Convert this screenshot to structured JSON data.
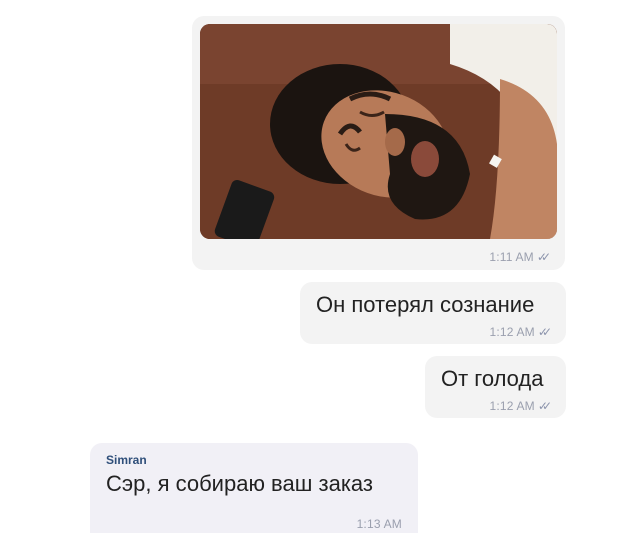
{
  "messages": [
    {
      "type": "image",
      "direction": "outgoing",
      "time": "1:11 AM",
      "status": "read",
      "image": {
        "description": "photo"
      }
    },
    {
      "type": "text",
      "direction": "outgoing",
      "text": "Он потерял сознание",
      "time": "1:12 AM",
      "status": "read"
    },
    {
      "type": "text",
      "direction": "outgoing",
      "text": "От голода",
      "time": "1:12 AM",
      "status": "read"
    },
    {
      "type": "text",
      "direction": "incoming",
      "sender": "Simran",
      "text": "Сэр, я собираю ваш заказ",
      "time": "1:13 AM"
    }
  ],
  "colors": {
    "outgoing_bubble": "#f3f3f3",
    "incoming_bubble": "#f1f0f6",
    "sender_name": "#2f4f7a",
    "meta_text": "#9a9fae"
  },
  "icons": {
    "read_status": "double-check-icon"
  }
}
